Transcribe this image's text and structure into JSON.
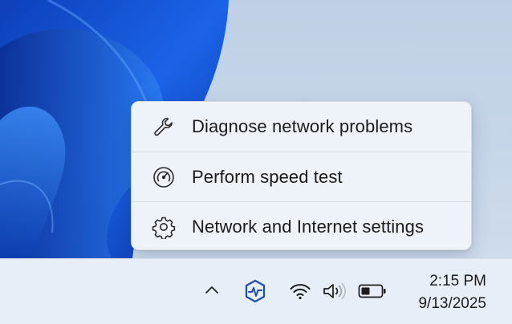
{
  "context_menu": {
    "items": [
      {
        "label": "Diagnose network problems",
        "icon": "wrench-icon"
      },
      {
        "label": "Perform speed test",
        "icon": "speedometer-icon"
      },
      {
        "label": "Network and Internet settings",
        "icon": "gear-icon"
      }
    ]
  },
  "taskbar": {
    "tray_icons": [
      "chevron-up-icon",
      "network-app-icon",
      "wifi-icon",
      "volume-icon",
      "battery-icon"
    ],
    "clock": {
      "time": "2:15 PM",
      "date": "9/13/2025"
    }
  },
  "colors": {
    "wallpaper_blue": "#1a56d6",
    "wallpaper_bg": "#c6d5e9",
    "menu_bg": "#eef2f9",
    "taskbar_bg": "#e8eef7",
    "app_icon_blue": "#1f4ea8"
  }
}
